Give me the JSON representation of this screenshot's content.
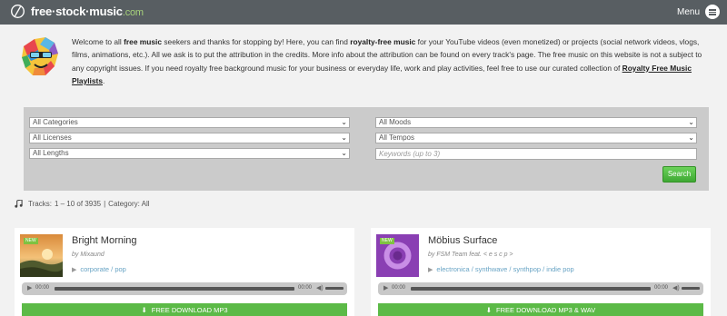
{
  "header": {
    "logo_text": "free·stock·music",
    "logo_tld": ".com",
    "menu_label": "Menu"
  },
  "intro": {
    "t1": "Welcome to all ",
    "b1": "free music",
    "t2": " seekers and thanks for stopping by! Here, you can find ",
    "b2": "royalty-free music",
    "t3": " for your YouTube videos (even monetized) or projects (social network videos, vlogs, films, animations, etc.). All we ask is to put the attribution in the credits. More info about the attribution can be found on every track's page. The free music on this website is not a subject to any copyright issues. If you need royalty free background music for your business or everyday life, work and play activities, feel free to use our curated collection of ",
    "link": "Royalty Free Music Playlists",
    "t4": "."
  },
  "filters": {
    "categories": "All Categories",
    "licenses": "All Licenses",
    "lengths": "All Lengths",
    "moods": "All Moods",
    "tempos": "All Tempos",
    "keywords_placeholder": "Keywords (up to 3)",
    "search_label": "Search"
  },
  "tracks_info": {
    "label": "Tracks:",
    "range": "1 – 10 of 3935",
    "sep": "|",
    "category": "Category: All"
  },
  "tracks": [
    {
      "badge": "NEW",
      "title": "Bright Morning",
      "author": "by Mixaund",
      "genres": "corporate / pop",
      "time": "00:00",
      "download_label": "FREE DOWNLOAD  MP3"
    },
    {
      "badge": "NEW",
      "title": "Möbius Surface",
      "author": "by FSM Team feat. < e s c p >",
      "genres": "electronica / synthwave / synthpop / indie pop",
      "time": "00:00",
      "download_label": "FREE DOWNLOAD  MP3 & WAV"
    }
  ],
  "colors": {
    "header_bg": "#585e62",
    "accent_green": "#5cba47",
    "genre_link": "#67a3c4"
  }
}
